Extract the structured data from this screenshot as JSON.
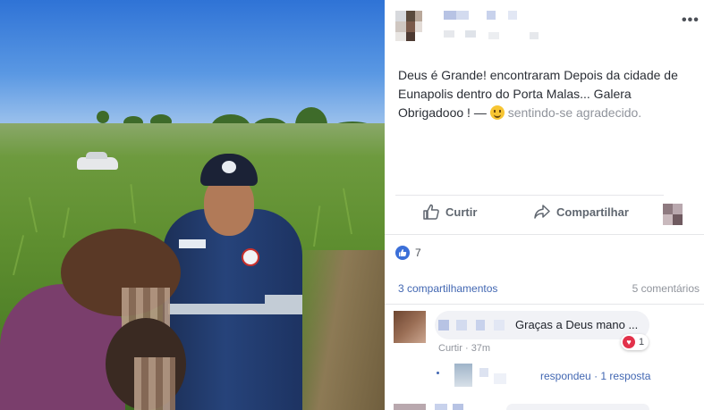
{
  "photo": {
    "description_icon": "photo-image"
  },
  "post": {
    "author_name": "",
    "menu_label": "•••",
    "text_main": "Deus é Grande! encontraram Depois da cidade de Eunapolis dentro do Porta Malas... Galera Obrigadooo ! —",
    "feeling_text": "sentindo-se agradecido.",
    "actions": {
      "comment_label": "Curtir",
      "share_label": "Compartilhar"
    },
    "likes_count": "7",
    "shares_label": "3 compartilhamentos",
    "comments_label": "5 comentários",
    "comment": {
      "text": "Graças a Deus mano ...",
      "reaction_count": "1",
      "like_link": "Curtir",
      "time": "37m",
      "reply_replied": "respondeu",
      "reply_count": "· 1 resposta"
    }
  },
  "colors": {
    "link": "#4267b2",
    "like_blue": "#3b6fd8",
    "heart_red": "#e2314a",
    "bubble": "#f1f2f6",
    "muted": "#90949c"
  }
}
